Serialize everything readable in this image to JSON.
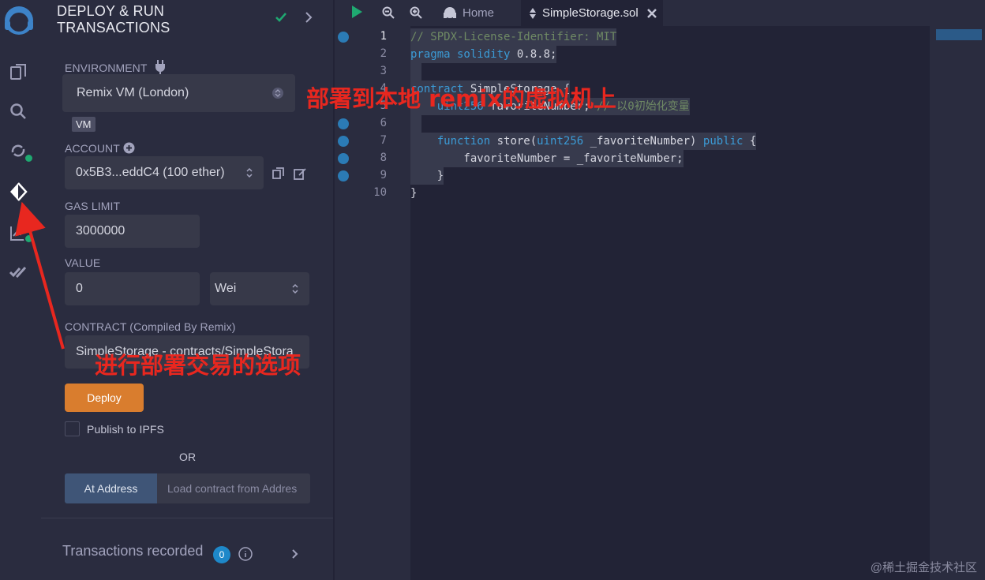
{
  "panel": {
    "title_line1": "DEPLOY & RUN",
    "title_line2": "TRANSACTIONS",
    "environment": {
      "label": "ENVIRONMENT",
      "value": "Remix VM (London)",
      "chip": "VM"
    },
    "account": {
      "label": "ACCOUNT",
      "value": "0x5B3...eddC4 (100 ether)"
    },
    "gas_limit": {
      "label": "GAS LIMIT",
      "value": "3000000"
    },
    "value": {
      "label": "VALUE",
      "amount": "0",
      "unit": "Wei"
    },
    "contract": {
      "label": "CONTRACT (Compiled By Remix)",
      "value": "SimpleStorage - contracts/SimpleStora"
    },
    "deploy_label": "Deploy",
    "publish_label": "Publish to IPFS",
    "or_label": "OR",
    "at_address_label": "At Address",
    "load_placeholder": "Load contract from Addres",
    "transactions": {
      "label": "Transactions recorded",
      "count": "0"
    }
  },
  "editor": {
    "home_tab": "Home",
    "file_tab": "SimpleStorage.sol",
    "lines": [
      "1",
      "2",
      "3",
      "4",
      "5",
      "6",
      "7",
      "8",
      "9",
      "10"
    ],
    "code": {
      "l1": "// SPDX-License-Identifier: MIT",
      "l2_kw": "pragma solidity",
      "l2_ver": " 0.8.8;",
      "l4_kw": "contract",
      "l4_rest": " SimpleStorage {",
      "l5_type": "    uint256",
      "l5_rest": " favoriteNumber; ",
      "l5_comment": "// 以0初始化变量",
      "l7_kw": "    function",
      "l7_a": " store(",
      "l7_type": "uint256",
      "l7_b": " _favoriteNumber) ",
      "l7_pub": "public",
      "l7_c": " {",
      "l8": "        favoriteNumber = _favoriteNumber;",
      "l9": "    }",
      "l10": "}"
    }
  },
  "annotations": {
    "vm_note": "部署到本地 remix的虚拟机上",
    "deploy_note": "进行部署交易的选项"
  },
  "watermark": "@稀土掘金技术社区",
  "colors": {
    "accent_deploy": "#d97d2e",
    "annotation": "#e8271f",
    "badge": "#1fa971",
    "count_badge": "#1e88c9"
  }
}
